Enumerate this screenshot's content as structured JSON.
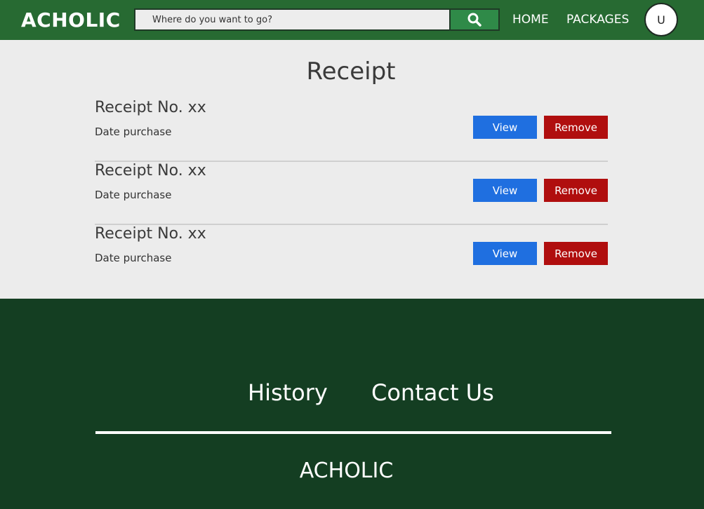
{
  "header": {
    "brand": "ACHOLIC",
    "search": {
      "placeholder": "Where do you want to go?",
      "value": ""
    },
    "nav": [
      {
        "label": "HOME"
      },
      {
        "label": "PACKAGES"
      }
    ],
    "avatar_initial": "U",
    "colors": {
      "navbar": "#276a32",
      "search_button": "#2f8a48"
    }
  },
  "main": {
    "title": "Receipt",
    "receipts": [
      {
        "title": "Receipt No. xx",
        "date": "Date purchase",
        "view_label": "View",
        "remove_label": "Remove"
      },
      {
        "title": "Receipt No. xx",
        "date": "Date purchase",
        "view_label": "View",
        "remove_label": "Remove"
      },
      {
        "title": "Receipt No. xx",
        "date": "Date purchase",
        "view_label": "View",
        "remove_label": "Remove"
      }
    ],
    "colors": {
      "view_button": "#1f6fe0",
      "remove_button": "#b00e0e"
    }
  },
  "footer": {
    "links": [
      {
        "label": "History"
      },
      {
        "label": "Contact Us"
      }
    ],
    "brand": "ACHOLIC",
    "colors": {
      "background": "#143e22"
    }
  },
  "icons": {
    "search": "search-icon"
  }
}
